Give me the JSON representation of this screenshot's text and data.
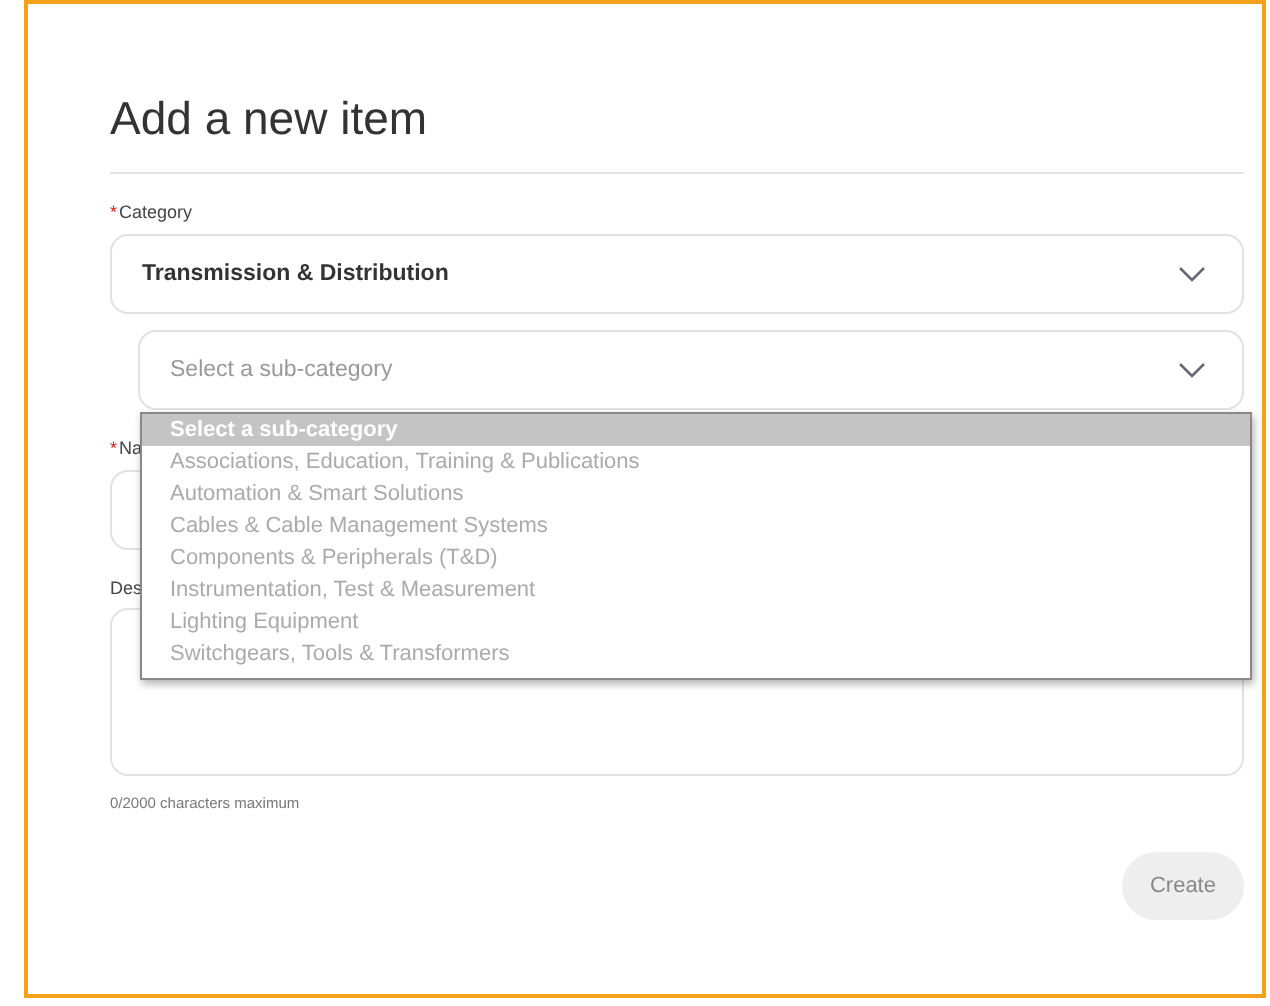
{
  "title": "Add a new item",
  "category": {
    "required_mark": "*",
    "label": "Category",
    "value": "Transmission & Distribution"
  },
  "sub_category": {
    "placeholder": "Select a sub-category",
    "expanded": true,
    "options": [
      {
        "label": "Select a sub-category",
        "selected": true
      },
      {
        "label": "Associations, Education, Training & Publications",
        "selected": false
      },
      {
        "label": "Automation & Smart Solutions",
        "selected": false
      },
      {
        "label": "Cables & Cable Management Systems",
        "selected": false
      },
      {
        "label": "Components & Peripherals (T&D)",
        "selected": false
      },
      {
        "label": "Instrumentation, Test & Measurement",
        "selected": false
      },
      {
        "label": "Lighting Equipment",
        "selected": false
      },
      {
        "label": "Switchgears, Tools & Transformers",
        "selected": false
      }
    ]
  },
  "name": {
    "required_mark": "*",
    "label": "Na"
  },
  "description": {
    "label": "Des",
    "counter": "0/2000 characters maximum"
  },
  "create_button": {
    "label": "Create",
    "disabled": true
  }
}
